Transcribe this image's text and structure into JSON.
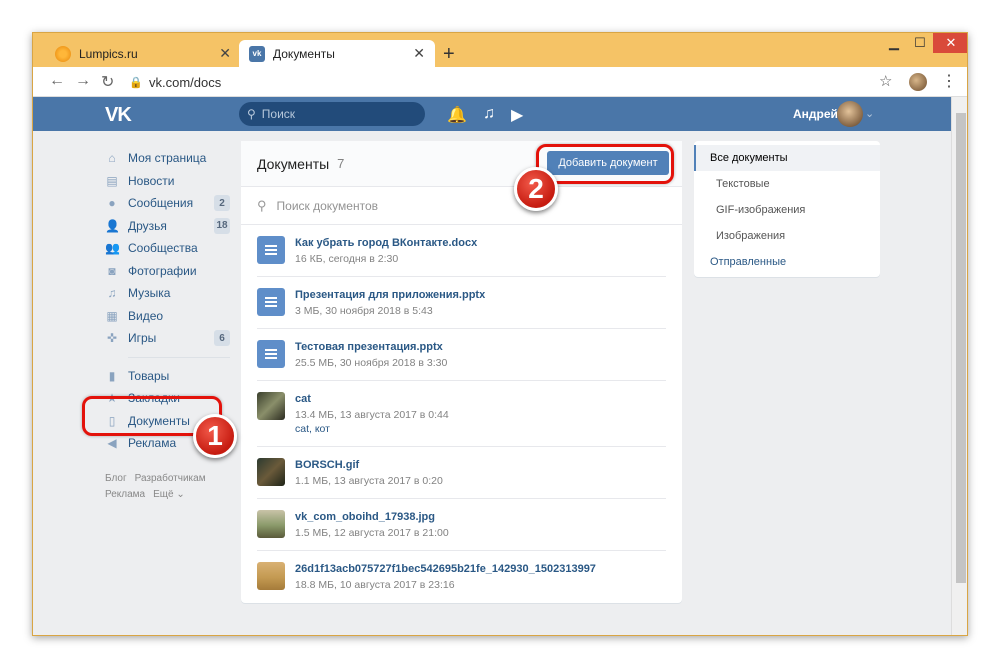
{
  "browser": {
    "tabs": [
      {
        "label": "Lumpics.ru",
        "close": "✕"
      },
      {
        "label": "Документы",
        "close": "✕"
      }
    ],
    "new_tab": "+",
    "url": "vk.com/docs",
    "window_controls": {
      "min": "▁",
      "max": "☐",
      "close": "✕"
    }
  },
  "vk_header": {
    "logo": "VK",
    "search_placeholder": "Поиск",
    "user_name": "Андрей"
  },
  "sidebar": {
    "items": [
      {
        "label": "Моя страница",
        "icon": "home-icon",
        "glyph": "⌂"
      },
      {
        "label": "Новости",
        "icon": "news-icon",
        "glyph": "▤"
      },
      {
        "label": "Сообщения",
        "icon": "messages-icon",
        "glyph": "●",
        "badge": "2"
      },
      {
        "label": "Друзья",
        "icon": "friends-icon",
        "glyph": "👤",
        "badge": "18"
      },
      {
        "label": "Сообщества",
        "icon": "groups-icon",
        "glyph": "👥"
      },
      {
        "label": "Фотографии",
        "icon": "camera-icon",
        "glyph": "◙"
      },
      {
        "label": "Музыка",
        "icon": "music-icon",
        "glyph": "♫"
      },
      {
        "label": "Видео",
        "icon": "video-icon",
        "glyph": "▦"
      },
      {
        "label": "Игры",
        "icon": "gamepad-icon",
        "glyph": "✜",
        "badge": "6"
      }
    ],
    "items2": [
      {
        "label": "Товары",
        "icon": "bag-icon",
        "glyph": "▮"
      },
      {
        "label": "Закладки",
        "icon": "star-icon",
        "glyph": "★"
      },
      {
        "label": "Документы",
        "icon": "document-icon",
        "glyph": "▯"
      },
      {
        "label": "Реклама",
        "icon": "megaphone-icon",
        "glyph": "◀"
      }
    ],
    "footer": [
      "Блог",
      "Разработчикам",
      "Реклама",
      "Ещё ⌄"
    ]
  },
  "docs": {
    "title": "Документы",
    "count": "7",
    "add_button": "Добавить документ",
    "search_placeholder": "Поиск документов",
    "items": [
      {
        "name": "Как убрать город ВКонтакте.docx",
        "meta": "16 КБ, сегодня в 2:30"
      },
      {
        "name": "Презентация для приложения.pptx",
        "meta": "3 МБ, 30 ноября 2018 в 5:43"
      },
      {
        "name": "Тестовая презентация.pptx",
        "meta": "25.5 МБ, 30 ноября 2018 в 3:30"
      },
      {
        "name": "cat",
        "meta": "13.4 МБ, 13 августа 2017 в 0:44",
        "tags": "cat, кот"
      },
      {
        "name": "BORSCH.gif",
        "meta": "1.1 МБ, 13 августа 2017 в 0:20"
      },
      {
        "name": "vk_com_oboihd_17938.jpg",
        "meta": "1.5 МБ, 12 августа 2017 в 21:00"
      },
      {
        "name": "26d1f13acb075727f1bec542695b21fe_142930_1502313997",
        "meta": "18.8 МБ, 10 августа 2017 в 23:16"
      }
    ]
  },
  "filter_menu": {
    "items": [
      "Все документы",
      "Текстовые",
      "GIF-изображения",
      "Изображения",
      "Отправленные"
    ]
  },
  "callouts": [
    "1",
    "2"
  ],
  "colors": {
    "vk_blue": "#4a76a8",
    "link": "#2a5885",
    "accent_red": "#e3120b"
  }
}
